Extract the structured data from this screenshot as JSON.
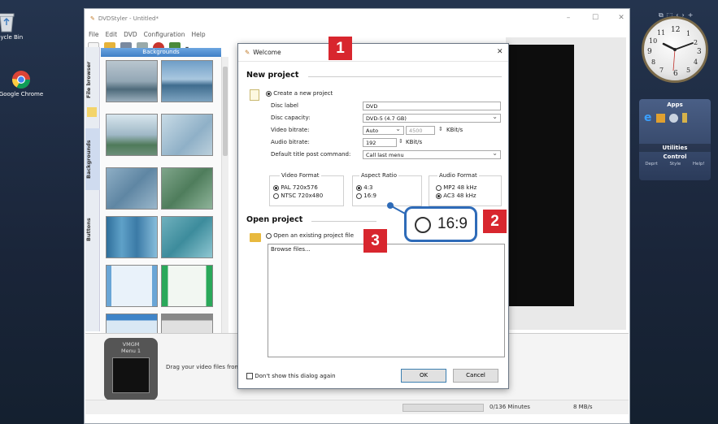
{
  "desktop": {
    "icons": [
      {
        "label": "Recycle Bin"
      },
      {
        "label": "Google Chrome"
      }
    ],
    "systray": {
      "buttons": [
        "⧉",
        "⬚",
        "‹",
        "›",
        "+"
      ]
    }
  },
  "app": {
    "title": "DVDStyler - Untitled*",
    "menu": [
      "File",
      "Edit",
      "DVD",
      "Configuration",
      "Help"
    ],
    "panel_header": "Backgrounds",
    "vertical_tabs": [
      "File browser",
      "Backgrounds",
      "Buttons"
    ],
    "vmgm": {
      "line1": "VMGM",
      "line2": "Menu 1"
    },
    "drag_hint": "Drag your video files from",
    "status": {
      "minutes": "0/136 Minutes",
      "rate": "8 MB/s"
    }
  },
  "dialog": {
    "title": "Welcome",
    "new_project": {
      "heading": "New project",
      "create_label": "Create a new project",
      "fields": [
        {
          "label": "Disc label",
          "value": "DVD"
        },
        {
          "label": "Disc capacity:",
          "value": "DVD-5 (4.7 GB)"
        },
        {
          "label": "Video bitrate:",
          "value": "Auto",
          "extra_value": "4500",
          "unit": "KBit/s"
        },
        {
          "label": "Audio bitrate:",
          "value": "192",
          "unit": "KBit/s"
        },
        {
          "label": "Default title post command:",
          "value": "Call last menu"
        }
      ],
      "video_format": {
        "title": "Video Format",
        "options": [
          "PAL 720x576",
          "NTSC 720x480"
        ],
        "selected": 0
      },
      "aspect_ratio": {
        "title": "Aspect Ratio",
        "options": [
          "4:3",
          "16:9"
        ],
        "selected": 0
      },
      "audio_format": {
        "title": "Audio Format",
        "options": [
          "MP2 48 kHz",
          "AC3 48 kHz"
        ],
        "selected": 1
      }
    },
    "open_project": {
      "heading": "Open project",
      "open_label": "Open an existing project file",
      "list_first": "Browse files..."
    },
    "dont_show": "Don't show this dialog again",
    "ok_label": "OK",
    "cancel_label": "Cancel"
  },
  "callouts": {
    "one": "1",
    "two": "2",
    "three": "3",
    "zoom_label": "16:9"
  },
  "gadgets": {
    "clock_numbers": [
      "12",
      "1",
      "2",
      "3",
      "4",
      "5",
      "6",
      "7",
      "8",
      "9",
      "10",
      "11"
    ],
    "apps_title": "Apps",
    "utilities": "Utilities",
    "control": "Control",
    "bottom": [
      "Deprt",
      "Style",
      "Help!"
    ]
  },
  "colors": {
    "accent": "#d8262e",
    "link_blue": "#2e6bb8"
  }
}
